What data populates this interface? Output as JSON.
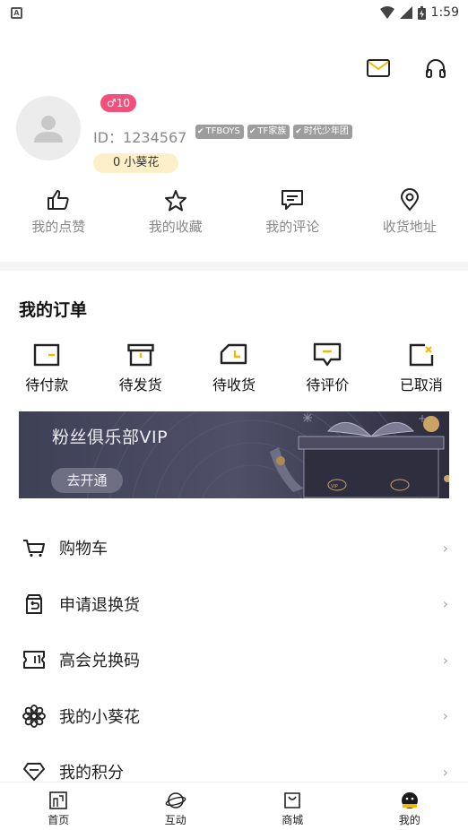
{
  "status_bar": {
    "time": "1:59",
    "notification_icon": "a-notification-icon"
  },
  "header": {
    "icons": [
      "mail-icon",
      "headphones-icon"
    ]
  },
  "profile": {
    "gender_level": "♂10",
    "id_text": "ID：1234567",
    "tags": [
      "TFBOYS",
      "TF家族",
      "时代少年团"
    ],
    "coins": "0 小葵花"
  },
  "quick_actions": [
    {
      "label": "我的点赞",
      "icon": "thumbs-up-icon"
    },
    {
      "label": "我的收藏",
      "icon": "star-icon"
    },
    {
      "label": "我的评论",
      "icon": "comment-icon"
    },
    {
      "label": "收货地址",
      "icon": "location-pin-icon"
    }
  ],
  "orders": {
    "title": "我的订单",
    "items": [
      {
        "label": "待付款",
        "icon": "wallet-icon"
      },
      {
        "label": "待发货",
        "icon": "box-icon"
      },
      {
        "label": "待收货",
        "icon": "truck-icon"
      },
      {
        "label": "待评价",
        "icon": "review-icon"
      },
      {
        "label": "已取消",
        "icon": "cancel-icon"
      }
    ]
  },
  "banner": {
    "title": "粉丝俱乐部VIP",
    "button": "去开通",
    "badge": "VIP"
  },
  "menu": [
    {
      "label": "购物车",
      "icon": "cart-icon"
    },
    {
      "label": "申请退换货",
      "icon": "return-icon"
    },
    {
      "label": "高会兑换码",
      "icon": "ticket-icon"
    },
    {
      "label": "我的小葵花",
      "icon": "flower-icon"
    },
    {
      "label": "我的积分",
      "icon": "diamond-icon"
    }
  ],
  "tabbar": [
    {
      "label": "首页",
      "icon": "home-icon"
    },
    {
      "label": "互动",
      "icon": "planet-icon"
    },
    {
      "label": "商城",
      "icon": "shopping-bag-icon"
    },
    {
      "label": "我的",
      "icon": "profile-face-icon"
    }
  ],
  "colors": {
    "accent": "#f5b800",
    "gender_badge": "#f2507a",
    "coins_bg": "#fdf0c8",
    "banner_bg": "#464759"
  }
}
